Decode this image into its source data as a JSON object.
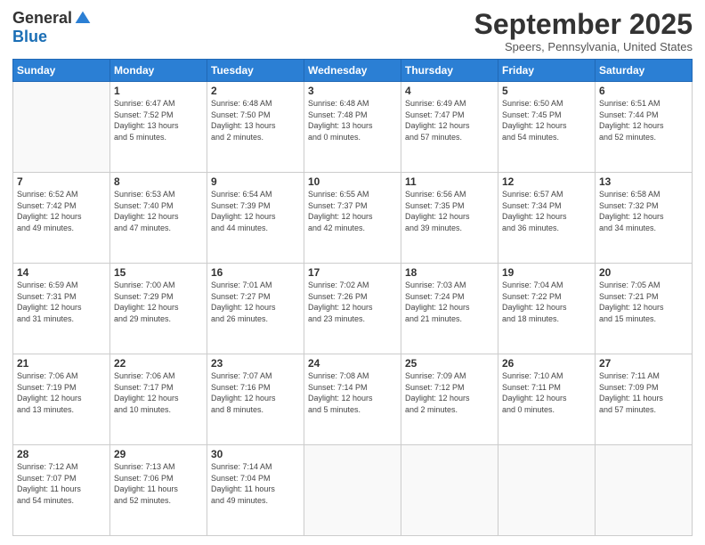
{
  "logo": {
    "general": "General",
    "blue": "Blue"
  },
  "title": "September 2025",
  "location": "Speers, Pennsylvania, United States",
  "days_of_week": [
    "Sunday",
    "Monday",
    "Tuesday",
    "Wednesday",
    "Thursday",
    "Friday",
    "Saturday"
  ],
  "weeks": [
    [
      {
        "day": "",
        "info": ""
      },
      {
        "day": "1",
        "info": "Sunrise: 6:47 AM\nSunset: 7:52 PM\nDaylight: 13 hours\nand 5 minutes."
      },
      {
        "day": "2",
        "info": "Sunrise: 6:48 AM\nSunset: 7:50 PM\nDaylight: 13 hours\nand 2 minutes."
      },
      {
        "day": "3",
        "info": "Sunrise: 6:48 AM\nSunset: 7:48 PM\nDaylight: 13 hours\nand 0 minutes."
      },
      {
        "day": "4",
        "info": "Sunrise: 6:49 AM\nSunset: 7:47 PM\nDaylight: 12 hours\nand 57 minutes."
      },
      {
        "day": "5",
        "info": "Sunrise: 6:50 AM\nSunset: 7:45 PM\nDaylight: 12 hours\nand 54 minutes."
      },
      {
        "day": "6",
        "info": "Sunrise: 6:51 AM\nSunset: 7:44 PM\nDaylight: 12 hours\nand 52 minutes."
      }
    ],
    [
      {
        "day": "7",
        "info": "Sunrise: 6:52 AM\nSunset: 7:42 PM\nDaylight: 12 hours\nand 49 minutes."
      },
      {
        "day": "8",
        "info": "Sunrise: 6:53 AM\nSunset: 7:40 PM\nDaylight: 12 hours\nand 47 minutes."
      },
      {
        "day": "9",
        "info": "Sunrise: 6:54 AM\nSunset: 7:39 PM\nDaylight: 12 hours\nand 44 minutes."
      },
      {
        "day": "10",
        "info": "Sunrise: 6:55 AM\nSunset: 7:37 PM\nDaylight: 12 hours\nand 42 minutes."
      },
      {
        "day": "11",
        "info": "Sunrise: 6:56 AM\nSunset: 7:35 PM\nDaylight: 12 hours\nand 39 minutes."
      },
      {
        "day": "12",
        "info": "Sunrise: 6:57 AM\nSunset: 7:34 PM\nDaylight: 12 hours\nand 36 minutes."
      },
      {
        "day": "13",
        "info": "Sunrise: 6:58 AM\nSunset: 7:32 PM\nDaylight: 12 hours\nand 34 minutes."
      }
    ],
    [
      {
        "day": "14",
        "info": "Sunrise: 6:59 AM\nSunset: 7:31 PM\nDaylight: 12 hours\nand 31 minutes."
      },
      {
        "day": "15",
        "info": "Sunrise: 7:00 AM\nSunset: 7:29 PM\nDaylight: 12 hours\nand 29 minutes."
      },
      {
        "day": "16",
        "info": "Sunrise: 7:01 AM\nSunset: 7:27 PM\nDaylight: 12 hours\nand 26 minutes."
      },
      {
        "day": "17",
        "info": "Sunrise: 7:02 AM\nSunset: 7:26 PM\nDaylight: 12 hours\nand 23 minutes."
      },
      {
        "day": "18",
        "info": "Sunrise: 7:03 AM\nSunset: 7:24 PM\nDaylight: 12 hours\nand 21 minutes."
      },
      {
        "day": "19",
        "info": "Sunrise: 7:04 AM\nSunset: 7:22 PM\nDaylight: 12 hours\nand 18 minutes."
      },
      {
        "day": "20",
        "info": "Sunrise: 7:05 AM\nSunset: 7:21 PM\nDaylight: 12 hours\nand 15 minutes."
      }
    ],
    [
      {
        "day": "21",
        "info": "Sunrise: 7:06 AM\nSunset: 7:19 PM\nDaylight: 12 hours\nand 13 minutes."
      },
      {
        "day": "22",
        "info": "Sunrise: 7:06 AM\nSunset: 7:17 PM\nDaylight: 12 hours\nand 10 minutes."
      },
      {
        "day": "23",
        "info": "Sunrise: 7:07 AM\nSunset: 7:16 PM\nDaylight: 12 hours\nand 8 minutes."
      },
      {
        "day": "24",
        "info": "Sunrise: 7:08 AM\nSunset: 7:14 PM\nDaylight: 12 hours\nand 5 minutes."
      },
      {
        "day": "25",
        "info": "Sunrise: 7:09 AM\nSunset: 7:12 PM\nDaylight: 12 hours\nand 2 minutes."
      },
      {
        "day": "26",
        "info": "Sunrise: 7:10 AM\nSunset: 7:11 PM\nDaylight: 12 hours\nand 0 minutes."
      },
      {
        "day": "27",
        "info": "Sunrise: 7:11 AM\nSunset: 7:09 PM\nDaylight: 11 hours\nand 57 minutes."
      }
    ],
    [
      {
        "day": "28",
        "info": "Sunrise: 7:12 AM\nSunset: 7:07 PM\nDaylight: 11 hours\nand 54 minutes."
      },
      {
        "day": "29",
        "info": "Sunrise: 7:13 AM\nSunset: 7:06 PM\nDaylight: 11 hours\nand 52 minutes."
      },
      {
        "day": "30",
        "info": "Sunrise: 7:14 AM\nSunset: 7:04 PM\nDaylight: 11 hours\nand 49 minutes."
      },
      {
        "day": "",
        "info": ""
      },
      {
        "day": "",
        "info": ""
      },
      {
        "day": "",
        "info": ""
      },
      {
        "day": "",
        "info": ""
      }
    ]
  ]
}
